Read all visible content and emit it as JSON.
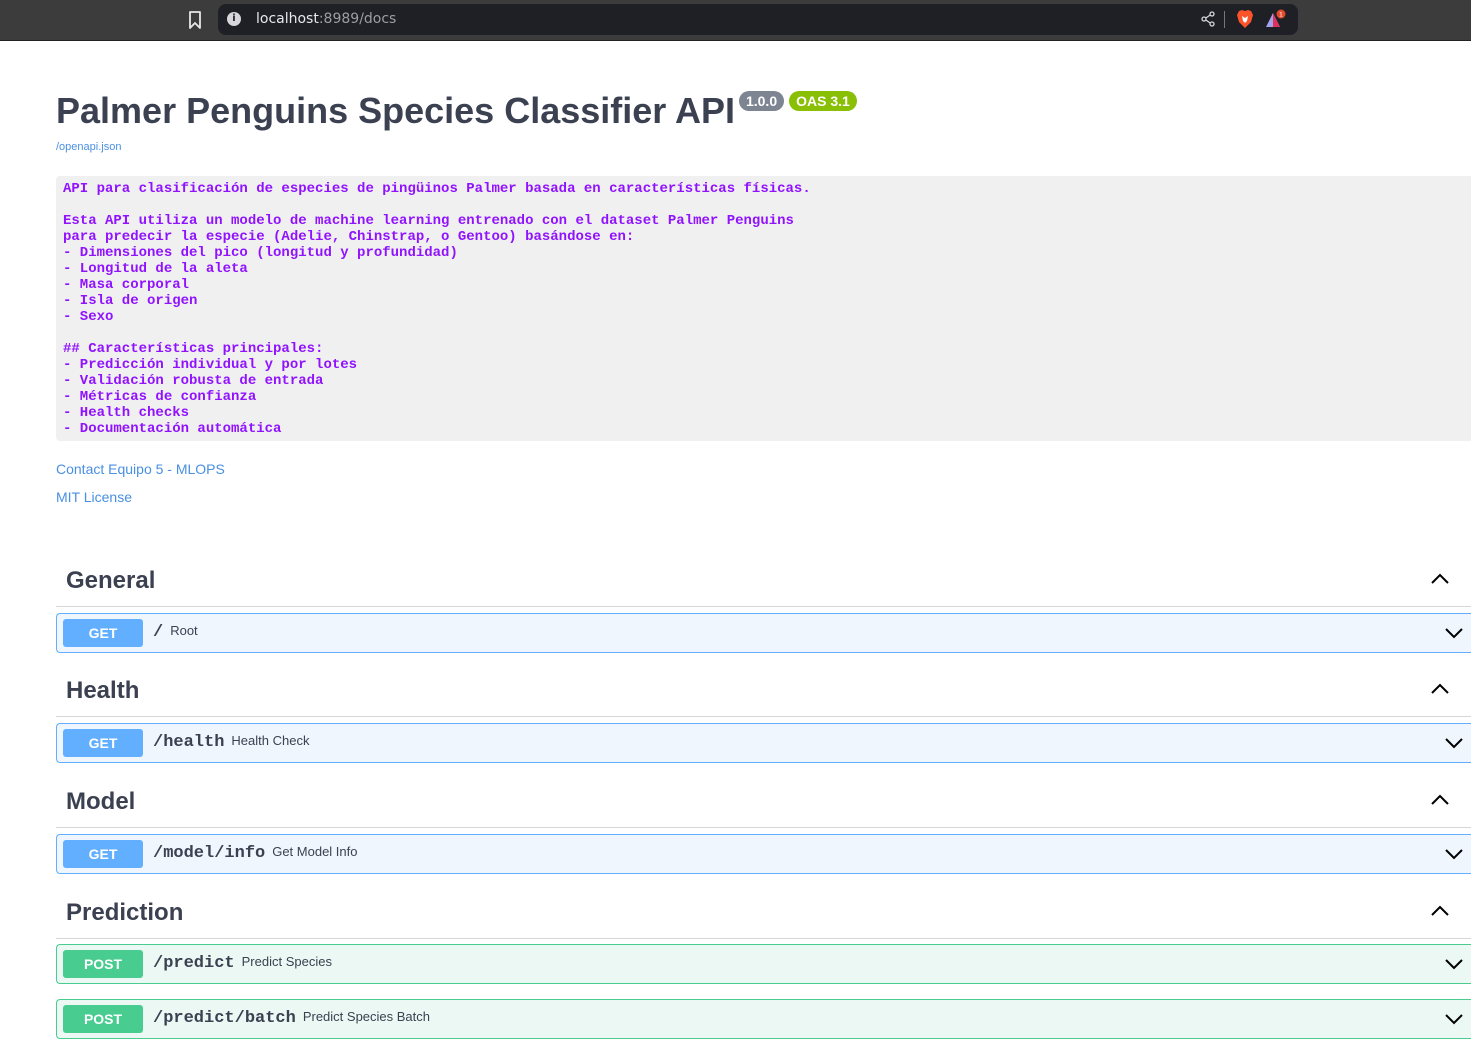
{
  "browser": {
    "url_host": "localhost",
    "url_path": ":8989/docs"
  },
  "info": {
    "title": "Palmer Penguins Species Classifier API",
    "version": "1.0.0",
    "oas": "OAS 3.1",
    "openapi_link": "/openapi.json",
    "description": "API para clasificación de especies de pingüinos Palmer basada en características físicas.\n\nEsta API utiliza un modelo de machine learning entrenado con el dataset Palmer Penguins\npara predecir la especie (Adelie, Chinstrap, o Gentoo) basándose en:\n- Dimensiones del pico (longitud y profundidad)\n- Longitud de la aleta\n- Masa corporal\n- Isla de origen\n- Sexo\n\n## Características principales:\n- Predicción individual y por lotes\n- Validación robusta de entrada\n- Métricas de confianza\n- Health checks\n- Documentación automática",
    "contact": "Contact Equipo 5 - MLOPS",
    "license": "MIT License"
  },
  "tags": [
    {
      "name": "General",
      "operations": [
        {
          "method": "GET",
          "path": "/",
          "summary": "Root"
        }
      ]
    },
    {
      "name": "Health",
      "operations": [
        {
          "method": "GET",
          "path": "/health",
          "summary": "Health Check"
        }
      ]
    },
    {
      "name": "Model",
      "operations": [
        {
          "method": "GET",
          "path": "/model/info",
          "summary": "Get Model Info"
        }
      ]
    },
    {
      "name": "Prediction",
      "operations": [
        {
          "method": "POST",
          "path": "/predict",
          "summary": "Predict Species"
        },
        {
          "method": "POST",
          "path": "/predict/batch",
          "summary": "Predict Species Batch"
        }
      ]
    }
  ],
  "colors": {
    "get": "#61affe",
    "post": "#49cc90",
    "link": "#4990e2",
    "description_text": "#9012fe"
  }
}
